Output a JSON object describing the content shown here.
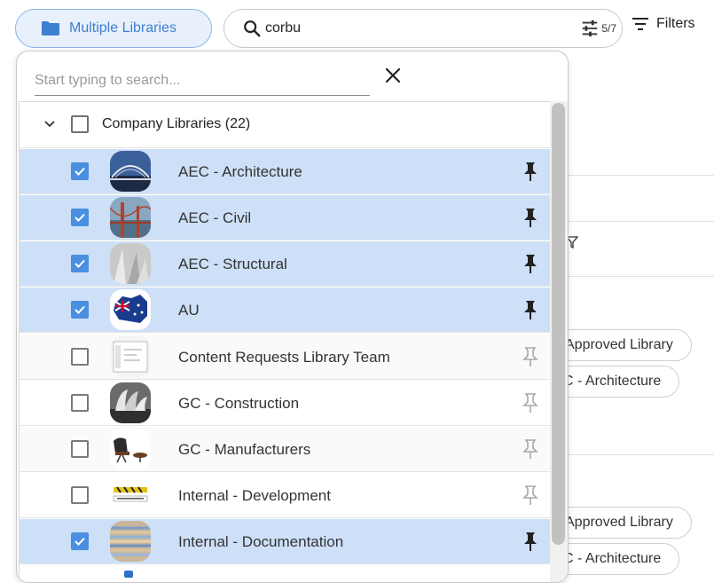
{
  "toolbar": {
    "library_button_label": "Multiple Libraries",
    "search_value": "corbu",
    "filter_count": "5/7",
    "filters_label": "Filters"
  },
  "background": {
    "pills": [
      {
        "text": "Approved Library"
      },
      {
        "text": "C - Architecture"
      },
      {
        "text": "Approved Library"
      },
      {
        "text": "C - Architecture"
      }
    ]
  },
  "dropdown": {
    "search_placeholder": "Start typing to search...",
    "group": {
      "label": "Company Libraries",
      "count": "(22)"
    },
    "items": [
      {
        "label": "AEC - Architecture",
        "checked": true,
        "pinned": true,
        "thumb": "bridge-photo"
      },
      {
        "label": "AEC - Civil",
        "checked": true,
        "pinned": true,
        "thumb": "golden-gate-photo"
      },
      {
        "label": "AEC - Structural",
        "checked": true,
        "pinned": true,
        "thumb": "structure-photo"
      },
      {
        "label": "AU",
        "checked": true,
        "pinned": true,
        "thumb": "australia-flag-map"
      },
      {
        "label": "Content Requests Library Team",
        "checked": false,
        "pinned": false,
        "thumb": "screenshot-thumb"
      },
      {
        "label": "GC - Construction",
        "checked": false,
        "pinned": false,
        "thumb": "opera-house-photo"
      },
      {
        "label": "GC - Manufacturers",
        "checked": false,
        "pinned": false,
        "thumb": "lounge-chair-photo"
      },
      {
        "label": "Internal - Development",
        "checked": false,
        "pinned": false,
        "thumb": "work-in-progress-sign"
      },
      {
        "label": "Internal - Documentation",
        "checked": true,
        "pinned": true,
        "thumb": "binders-photo"
      }
    ]
  },
  "colors": {
    "accent": "#4a8fe0",
    "selected_row": "#cde0f7",
    "library_button_bg": "#e8f0fb"
  }
}
